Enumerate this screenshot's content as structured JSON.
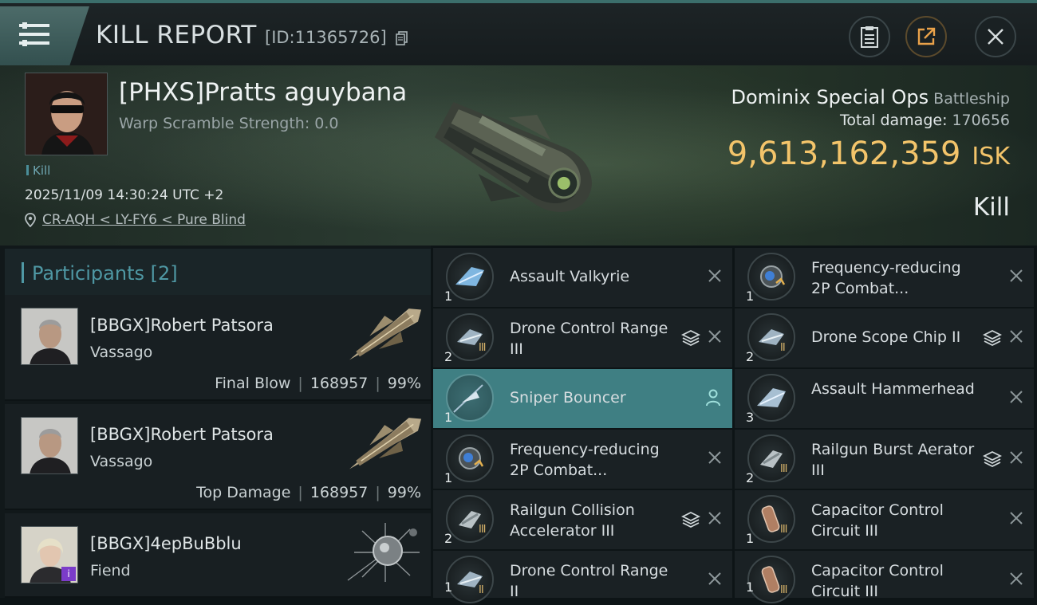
{
  "header": {
    "title": "KILL REPORT",
    "report_id": "[ID:11365726]"
  },
  "victim": {
    "name": "[PHXS]Pratts aguybana",
    "warp_scramble": "Warp Scramble Strength: 0.0",
    "kill_tag": "Kill",
    "datetime": "2025/11/09 14:30:24 UTC +2",
    "location": "CR-AQH < LY-FY6 < Pure Blind",
    "ship_name": "Dominix Special Ops",
    "ship_type": "Battleship",
    "total_damage_label": "Total damage:",
    "total_damage": "170656",
    "isk_value": "9,613,162,359",
    "isk_unit": "ISK",
    "result": "Kill"
  },
  "participants": {
    "label": "Participants [2]",
    "rows": [
      {
        "name": "[BBGX]Robert Patsora",
        "ship": "Vassago",
        "role": "Final Blow",
        "damage": "168957",
        "percent": "99%"
      },
      {
        "name": "[BBGX]Robert Patsora",
        "ship": "Vassago",
        "role": "Top Damage",
        "damage": "168957",
        "percent": "99%"
      },
      {
        "name": "[BBGX]4epBuBblu",
        "ship": "Fiend",
        "badge": "i"
      }
    ]
  },
  "modules": [
    {
      "qty": "1",
      "name": "Assault Valkyrie",
      "tier": ""
    },
    {
      "qty": "1",
      "name": "Frequency-reducing 2P Combat...",
      "tier": ""
    },
    {
      "qty": "2",
      "name": "Drone Control Range III",
      "tier": "III"
    },
    {
      "qty": "2",
      "name": "Drone Scope Chip II",
      "tier": "II"
    },
    {
      "qty": "1",
      "name": "Sniper  Bouncer",
      "tier": ""
    },
    {
      "qty": "3",
      "name": "Assault Hammerhead",
      "tier": ""
    },
    {
      "qty": "1",
      "name": "Frequency-reducing 2P Combat...",
      "tier": ""
    },
    {
      "qty": "2",
      "name": "Railgun Burst Aerator III",
      "tier": "III"
    },
    {
      "qty": "2",
      "name": "Railgun Collision Accelerator III",
      "tier": "III"
    },
    {
      "qty": "1",
      "name": "Capacitor Control Circuit III",
      "tier": "III"
    },
    {
      "qty": "1",
      "name": "Drone Control Range II",
      "tier": "II"
    },
    {
      "qty": "1",
      "name": "Capacitor Control Circuit III",
      "tier": "III"
    }
  ],
  "icons": {
    "menu": "menu-icon",
    "copy": "copy-icon",
    "clipboard": "clipboard-icon",
    "share": "share-icon",
    "close": "close-icon",
    "location": "location-pin-icon",
    "stack": "stack-icon",
    "remove": "x-icon",
    "person": "person-icon"
  },
  "colors": {
    "accent": "#4f98a4",
    "isk": "#f3c46a",
    "active_row": "#3f7f83",
    "badge": "#7b3cc9"
  }
}
